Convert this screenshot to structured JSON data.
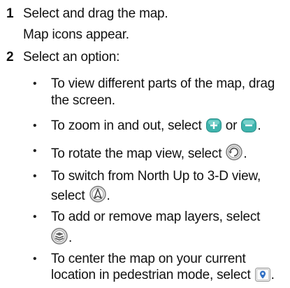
{
  "steps": [
    {
      "number": "1",
      "text": "Select and drag the map.",
      "result": "Map icons appear."
    },
    {
      "number": "2",
      "text": "Select an option:",
      "options": [
        {
          "bullet": "•",
          "line1": "To view different parts of the map, drag",
          "line2": "the screen."
        },
        {
          "bullet": "•",
          "pre": "To zoom in and out, select",
          "mid": "or",
          "post": ".",
          "icons": [
            "zoom-in-icon",
            "zoom-out-icon"
          ]
        },
        {
          "bullet": "•",
          "pre": "To rotate the map view, select",
          "post": ".",
          "icons": [
            "rotate-icon"
          ]
        },
        {
          "bullet": "•",
          "line1": "To switch from North Up to 3-D view,",
          "pre2": "select",
          "post": ".",
          "icons": [
            "north-up-3d-icon"
          ]
        },
        {
          "bullet": "•",
          "line1": "To add or remove map layers, select",
          "post": ".",
          "icons": [
            "map-layers-icon"
          ]
        },
        {
          "bullet": "•",
          "line1": "To center the map on your current",
          "pre2": "location in pedestrian mode, select",
          "post": ".",
          "icons": [
            "center-location-icon"
          ]
        }
      ]
    }
  ],
  "colors": {
    "zoom_button": "#3fb4ad",
    "icon_gray": "#8a8a8a"
  }
}
